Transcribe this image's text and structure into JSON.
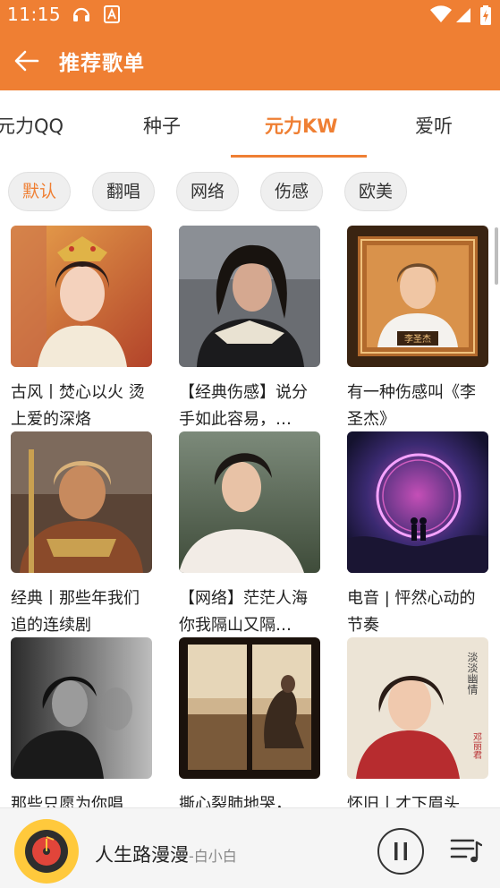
{
  "status_bar": {
    "time": "11:15"
  },
  "header": {
    "title": "推荐歌单"
  },
  "tabs": [
    {
      "label": "元力QQ",
      "active": false
    },
    {
      "label": "种子",
      "active": false
    },
    {
      "label": "元力KW",
      "active": true
    },
    {
      "label": "爱听",
      "active": false
    }
  ],
  "filters": [
    {
      "label": "默认",
      "active": true
    },
    {
      "label": "翻唱",
      "active": false
    },
    {
      "label": "网络",
      "active": false
    },
    {
      "label": "伤感",
      "active": false
    },
    {
      "label": "欧美",
      "active": false
    }
  ],
  "playlists": [
    {
      "title": "古风丨焚心以火 烫上爱的深烙"
    },
    {
      "title": "【经典伤感】说分手如此容易，…"
    },
    {
      "title": "有一种伤感叫《李圣杰》",
      "cover_text": "李圣杰"
    },
    {
      "title": "经典丨那些年我们追的连续剧"
    },
    {
      "title": "【网络】茫茫人海 你我隔山又隔…"
    },
    {
      "title": "电音 | 怦然心动的节奏"
    },
    {
      "title": "那些只愿为你唱"
    },
    {
      "title": "撕心裂肺地哭，"
    },
    {
      "title": "怀旧丨才下眉头",
      "cover_text": "邓丽君"
    }
  ],
  "player": {
    "song": "人生路漫漫",
    "artist": "-白小白"
  },
  "colors": {
    "accent": "#ef7f33"
  }
}
